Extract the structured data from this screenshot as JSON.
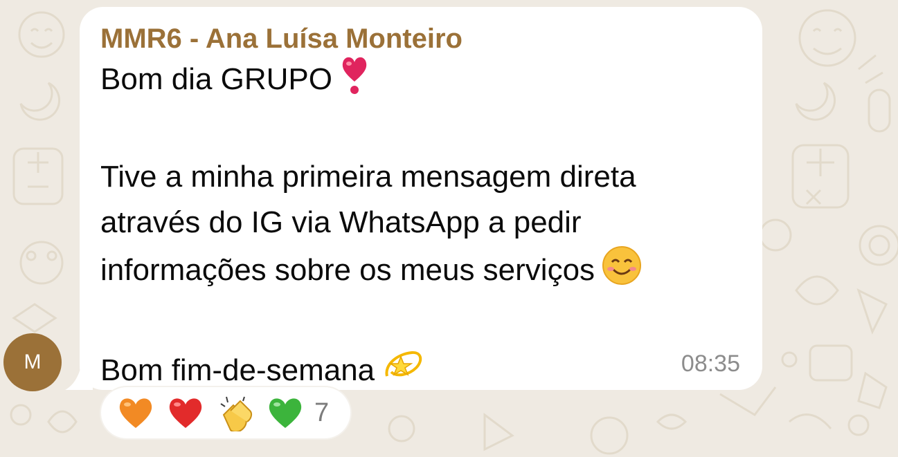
{
  "message": {
    "sender_name": "MMR6 - Ana Luísa Monteiro",
    "sender_initial": "M",
    "line1": "Bom dia GRUPO",
    "line2": "Tive a minha primeira mensagem direta",
    "line3": "através do IG via WhatsApp a pedir",
    "line4": "informações sobre os meus serviços",
    "line5": "Bom fim-de-semana",
    "time": "08:35",
    "emojis": [
      "heavy-exclamation-heart-icon",
      "smiling-face-icon",
      "dizzy-star-icon"
    ]
  },
  "reactions": {
    "icons": [
      "orange-heart-icon",
      "red-heart-icon",
      "clapping-hands-icon",
      "green-heart-icon"
    ],
    "count": "7"
  },
  "colors": {
    "background": "#efeae2",
    "sender": "#9b7138",
    "bubble": "#ffffff",
    "timestamp": "#8c8c8c"
  }
}
